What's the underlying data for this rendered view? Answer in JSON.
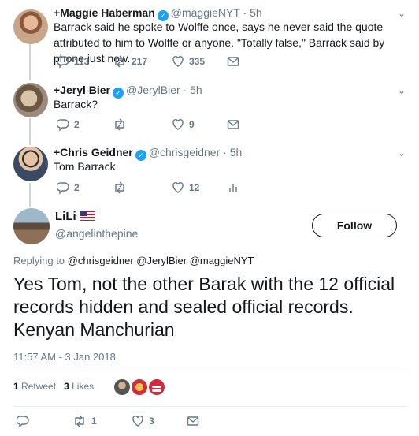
{
  "thread": [
    {
      "name": "+Maggie Haberman",
      "handle": "@maggieNYT",
      "dot": "·",
      "time": "5h",
      "text": "Barrack said he spoke to Wolffe once, says he never said the quote attributed to him to Wolffe or anyone. \"Totally false,\" Barrack said by phone just now.",
      "replies": "113",
      "retweets": "217",
      "likes": "335"
    },
    {
      "name": "+Jeryl Bier",
      "handle": "@JerylBier",
      "dot": "·",
      "time": "5h",
      "text": "Barrack?",
      "replies": "2",
      "retweets": "",
      "likes": "9"
    },
    {
      "name": "+Chris Geidner",
      "handle": "@chrisgeidner",
      "dot": "·",
      "time": "5h",
      "text": "Tom Barrack.",
      "replies": "2",
      "retweets": "",
      "likes": "12"
    }
  ],
  "main_tweet": {
    "name": "LiLi",
    "handle": "@angelinthepine",
    "follow_label": "Follow",
    "replying_prefix": "Replying to",
    "replying_to": "@chrisgeidner @JerylBier @maggieNYT",
    "text": "Yes Tom, not the other Barak with the 12 official records hidden and sealed official records. Kenyan Manchurian",
    "timestamp": "11:57 AM - 3 Jan 2018",
    "retweet_count": "1",
    "retweet_label": "Retweet",
    "like_count": "3",
    "like_label": "Likes",
    "action_retweets": "1",
    "action_likes": "3"
  },
  "colors": {
    "text": "#14171a",
    "muted": "#657786",
    "verified": "#1da1f2",
    "thread_line": "#ccd6dd",
    "divider": "#e6ecf0"
  },
  "icons": [
    "reply-icon",
    "retweet-icon",
    "like-icon",
    "message-icon",
    "analytics-icon",
    "verified-icon",
    "chevron-down-icon",
    "us-flag-icon"
  ]
}
